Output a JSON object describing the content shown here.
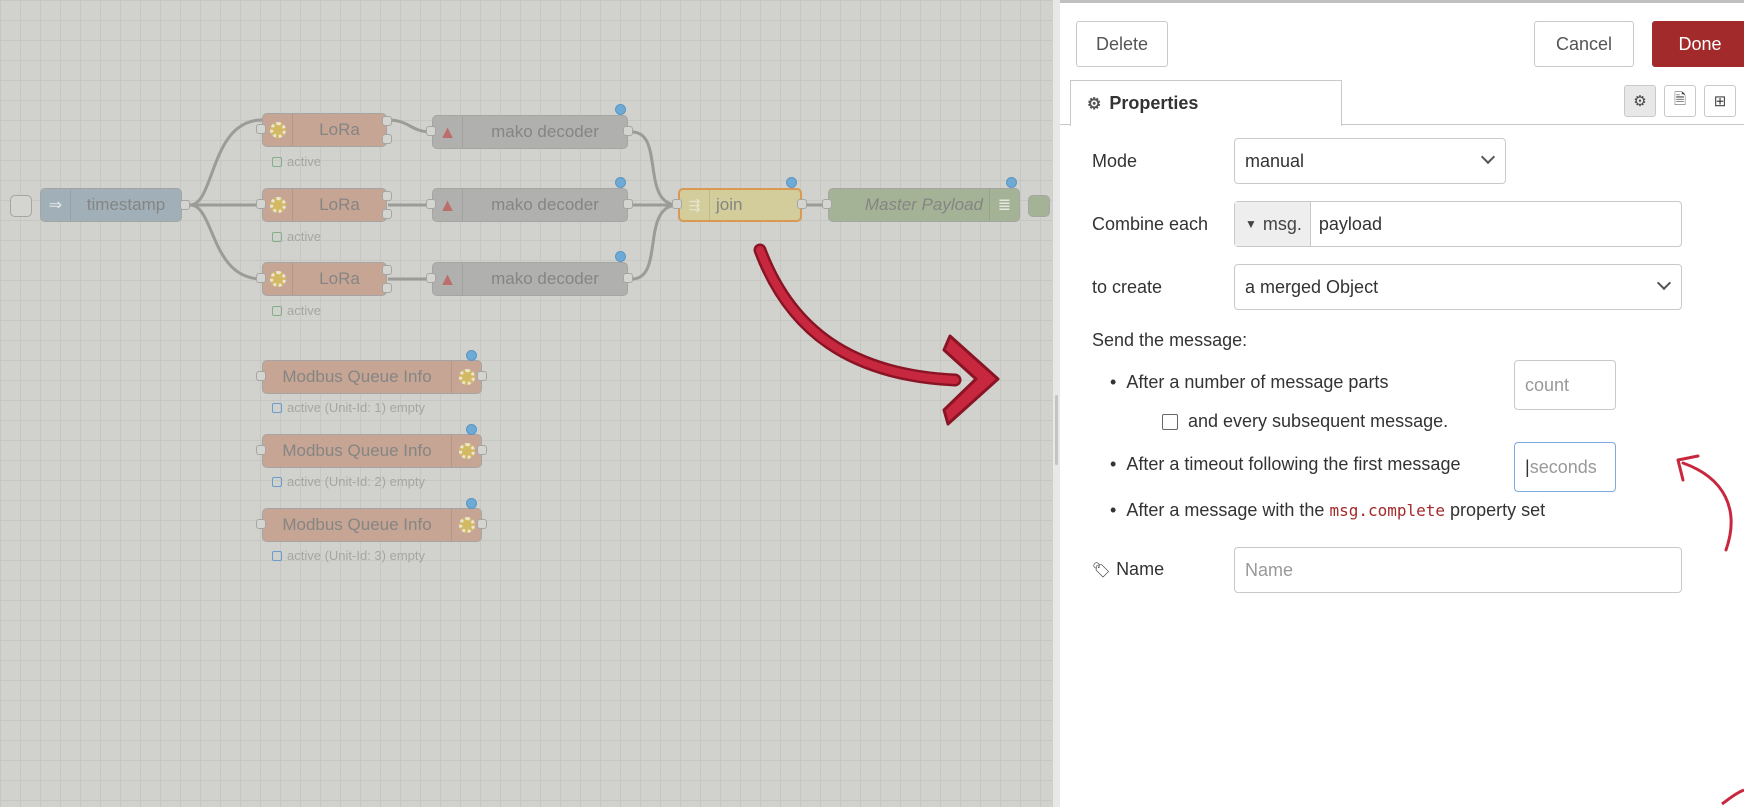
{
  "flow": {
    "inject_label": "timestamp",
    "lora_label": "LoRa",
    "lora_status": "active",
    "decoder_label": "mako decoder",
    "join_label": "join",
    "debug_label": "Master Payload",
    "modbus": [
      {
        "label": "Modbus Queue Info",
        "status": "active (Unit-Id: 1) empty"
      },
      {
        "label": "Modbus Queue Info",
        "status": "active (Unit-Id: 2) empty"
      },
      {
        "label": "Modbus Queue Info",
        "status": "active (Unit-Id: 3) empty"
      }
    ]
  },
  "editor": {
    "delete_label": "Delete",
    "cancel_label": "Cancel",
    "done_label": "Done",
    "tab_properties": "Properties",
    "mode_label": "Mode",
    "mode_value": "manual",
    "combine_label": "Combine each",
    "combine_type": "msg.",
    "combine_value": "payload",
    "create_label": "to create",
    "create_value": "a merged Object",
    "send_label": "Send the message:",
    "bullet_parts": "After a number of message parts",
    "count_placeholder": "count",
    "subsequent_label": "and every subsequent message.",
    "bullet_timeout": "After a timeout following the first message",
    "seconds_placeholder": "seconds",
    "bullet_complete_prefix": "After a message with the",
    "bullet_complete_code": "msg.complete",
    "bullet_complete_suffix": "property set",
    "name_label": "Name",
    "name_placeholder": "Name"
  },
  "colors": {
    "accent": "#a22a2a",
    "arrow": "#c8283f",
    "lora_node": "#c79a84",
    "decoder_node": "#a9a9a7",
    "join_node": "#d6cf8e",
    "debug_node": "#98ad87",
    "inject_node": "#94a9b5"
  },
  "icons": [
    "gear-icon",
    "document-icon",
    "hierarchy-icon",
    "tag-icon",
    "inject-arrows-icon",
    "lora-sun-icon",
    "decoder-warning-icon",
    "join-icon",
    "list-icon",
    "checkbox-icon"
  ]
}
